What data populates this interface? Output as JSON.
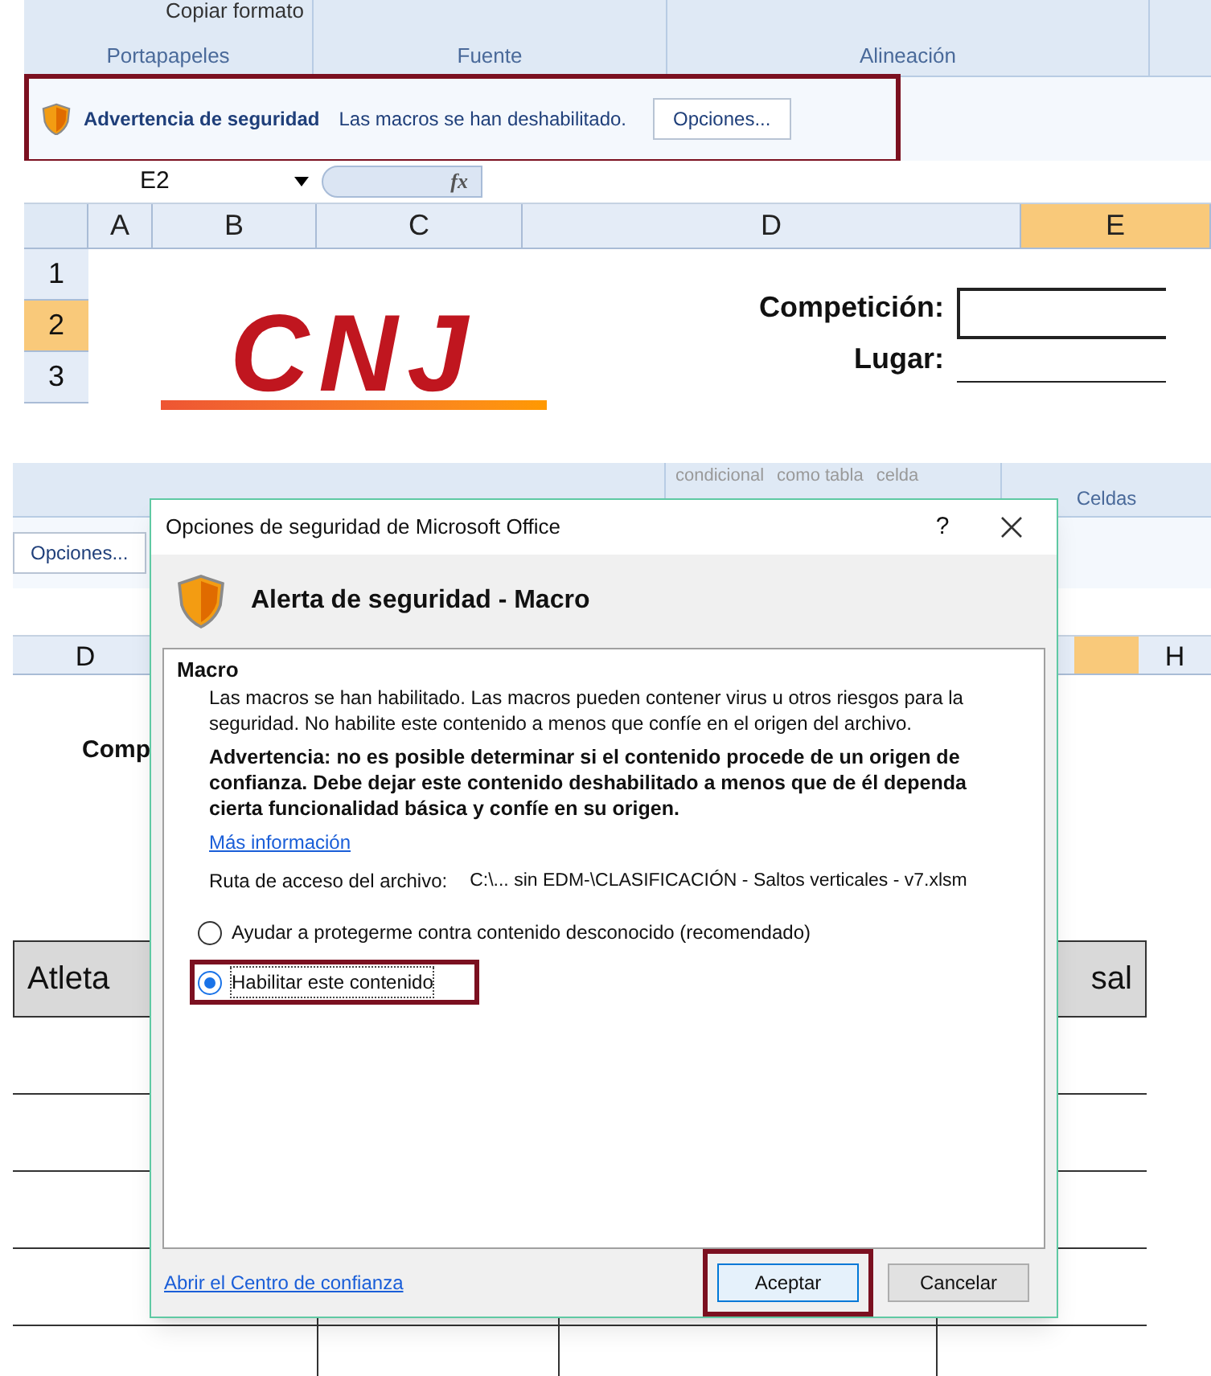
{
  "top": {
    "ribbon": {
      "button": "Copiar formato",
      "groups": [
        "Portapapeles",
        "Fuente",
        "Alineación"
      ]
    },
    "message_bar": {
      "title": "Advertencia de seguridad",
      "message": "Las macros se han deshabilitado.",
      "button": "Opciones...",
      "highlighted": true
    },
    "name_box": "E2",
    "function_label": "fx",
    "columns": [
      {
        "label": "A",
        "selected": false
      },
      {
        "label": "B",
        "selected": false
      },
      {
        "label": "C",
        "selected": false
      },
      {
        "label": "D",
        "selected": false
      },
      {
        "label": "E",
        "selected": true
      }
    ],
    "rows": [
      {
        "label": "1",
        "selected": false
      },
      {
        "label": "2",
        "selected": true
      },
      {
        "label": "3",
        "selected": false
      }
    ],
    "logo": "CNJ",
    "fields": [
      "Competición:",
      "Lugar:"
    ]
  },
  "bottom": {
    "ribbon": {
      "labels": [
        "condicional",
        "como tabla",
        "celda"
      ],
      "group": "Celdas"
    },
    "message_bar_button": "Opciones...",
    "columns": [
      {
        "label": "D"
      },
      {
        "label": "H"
      }
    ],
    "cell_text": "Comp",
    "table_headers": [
      "Atleta",
      "sal"
    ],
    "dialog": {
      "title": "Opciones de seguridad de Microsoft Office",
      "help": "?",
      "heading": "Alerta de seguridad - Macro",
      "section": "Macro",
      "intro": "Las macros se han habilitado. Las macros pueden contener virus u otros riesgos para la seguridad. No habilite este contenido a menos que confíe en el origen del archivo.",
      "warning": "Advertencia: no es posible determinar si el contenido procede de un origen de confianza. Debe dejar este contenido deshabilitado a menos que de él dependa cierta funcionalidad básica y confíe en su origen.",
      "link": "Más información",
      "path_label": "Ruta de acceso del archivo:",
      "path": "C:\\... sin EDM-\\CLASIFICACIÓN - Saltos verticales - v7.xlsm",
      "options": [
        {
          "label": "Ayudar a protegerme contra contenido desconocido (recomendado)",
          "selected": false,
          "highlighted": false
        },
        {
          "label": "Habilitar este contenido",
          "selected": true,
          "highlighted": true
        }
      ],
      "footer_link": "Abrir el Centro de confianza",
      "buttons": [
        {
          "label": "Aceptar",
          "default": true,
          "highlighted": true
        },
        {
          "label": "Cancelar",
          "default": false,
          "highlighted": false
        }
      ]
    }
  }
}
